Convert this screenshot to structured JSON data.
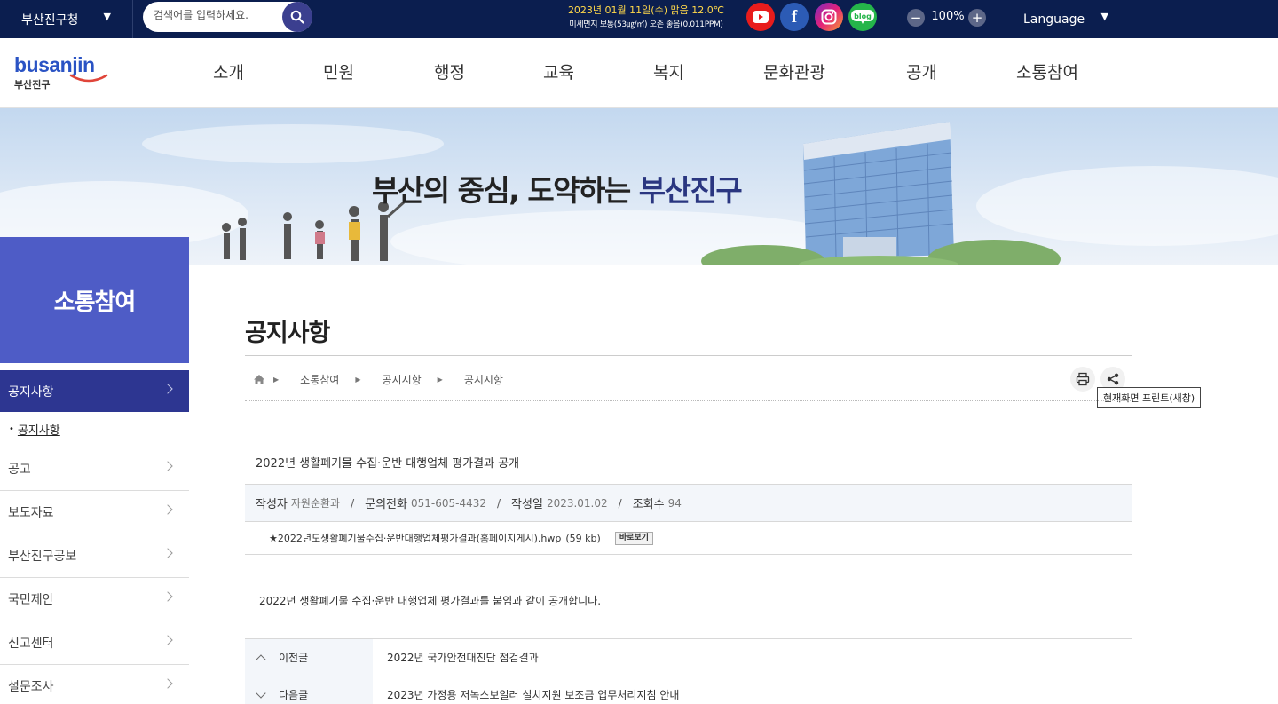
{
  "topbar": {
    "site_name": "부산진구청",
    "search_placeholder": "검색어를 입력하세요.",
    "weather_line1": "2023년 01월 11일(수) 맑음 12.0℃",
    "weather_line2": "미세먼지 보통(53㎍/㎥) 오존 좋음(0.011PPM)",
    "zoom_level": "100%",
    "language_label": "Language",
    "sns": [
      "youtube-icon",
      "facebook-icon",
      "instagram-icon",
      "blog-icon"
    ]
  },
  "logo": {
    "en": "busanjin",
    "kr": "부산진구"
  },
  "gnb": [
    "소개",
    "민원",
    "행정",
    "교육",
    "복지",
    "문화관광",
    "공개",
    "소통참여"
  ],
  "banner": {
    "slogan_prefix": "부산의 중심, 도약하는 ",
    "slogan_highlight": "부산진구"
  },
  "side": {
    "title": "소통참여",
    "items": [
      "공지사항",
      "공고",
      "보도자료",
      "부산진구공보",
      "국민제안",
      "신고센터",
      "설문조사"
    ],
    "sub_items": [
      "공지사항"
    ]
  },
  "content": {
    "page_title": "공지사항",
    "breadcrumb": [
      "소통참여",
      "공지시항",
      "공지시항"
    ],
    "print_tooltip": "현재화면 프린트(새창)"
  },
  "post": {
    "title": "2022년 생활폐기물 수집·운반 대행업체 평가결과 공개",
    "meta": {
      "author_label": "작성자",
      "author": "자원순환과",
      "phone_label": "문의전화",
      "phone": "051-605-4432",
      "date_label": "작성일",
      "date": "2023.01.02",
      "views_label": "조회수",
      "views": "94"
    },
    "file_name": "★2022년도생활폐기물수집·운반대행업체평가결과(홈페이지게시).hwp",
    "file_size": "(59 kb)",
    "view_button": "바로보기",
    "body": "2022년 생활폐기물 수집·운반 대행업체 평가결과를 붙임과 같이 공개합니다."
  },
  "post_nav": {
    "prev_label": "이전글",
    "prev_title": "2022년 국가안전대진단 점검결과",
    "next_label": "다음글",
    "next_title": "2023년 가정용 저녹스보일러 설치지원 보조금 업무처리지침 안내"
  },
  "colors": {
    "topbar": "#0b1e4f",
    "accent": "#4e5cc6",
    "active": "#2d3691",
    "weather_text": "#ffd84a"
  }
}
